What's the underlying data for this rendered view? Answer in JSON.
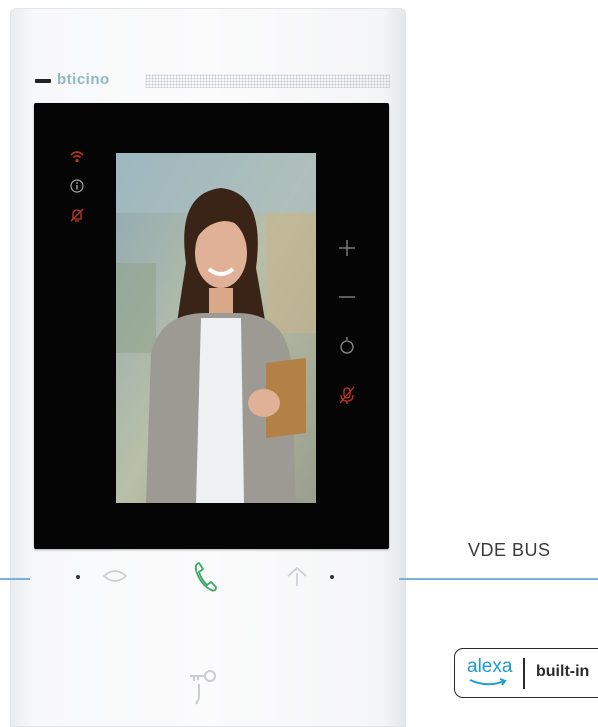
{
  "device": {
    "brand": "bticino",
    "screen_left_icons": [
      "wifi-icon",
      "info-icon",
      "do-not-disturb-icon"
    ],
    "screen_right_icons": [
      "volume-up-icon",
      "volume-down-icon",
      "brightness-icon",
      "mute-microphone-icon"
    ],
    "bottom_buttons": [
      "eye-icon",
      "phone-icon",
      "stairlight-icon",
      "door-key-icon"
    ],
    "accent_colors": {
      "status_icons": "#c2352a",
      "phone": "#3fa86a",
      "alexa": "#1f9bd7"
    }
  },
  "label": {
    "system": "VDE BUS"
  },
  "badge": {
    "alexa": "alexa",
    "built_in": "built-in"
  }
}
